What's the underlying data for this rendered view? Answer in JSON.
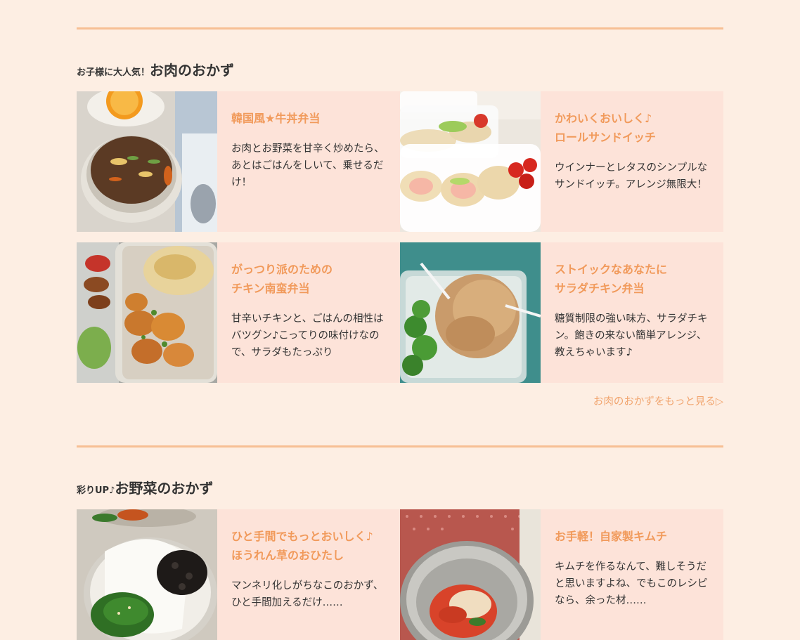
{
  "section1": {
    "title_small": "お子様に大人気！",
    "title_big": "お肉のおかず",
    "cards": [
      {
        "title": "韓国風★牛丼弁当",
        "text": "お肉とお野菜を甘辛く炒めたら、あとはごはんをしいて、乗せるだけ！",
        "image": "bulgogi-bento-photo"
      },
      {
        "title": "かわいくおいしく♪\nロールサンドイッチ",
        "text": "ウインナーとレタスのシンプルなサンドイッチ。アレンジ無限大！",
        "image": "roll-sandwich-photo"
      },
      {
        "title": "がっつり派のための\nチキン南蛮弁当",
        "text": "甘辛いチキンと、ごはんの相性はバツグン♪こってりの味付けなので、サラダもたっぷり",
        "image": "chicken-nanban-photo"
      },
      {
        "title": "ストイックなあなたに\nサラダチキン弁当",
        "text": "糖質制限の強い味方、サラダチキン。飽きの来ない簡単アレンジ、教えちゃいます♪",
        "image": "salad-chicken-photo"
      }
    ],
    "more_link": "お肉のおかずをもっと見る▷"
  },
  "section2": {
    "title_small": "彩りUP♪",
    "title_big": "お野菜のおかず",
    "cards": [
      {
        "title": "ひと手間でもっとおいしく♪\nほうれん草のおひたし",
        "text": "マンネリ化しがちなこのおかず、ひと手間加えるだけ……",
        "image": "spinach-ohitashi-photo"
      },
      {
        "title": "お手軽！自家製キムチ",
        "text": "キムチを作るなんて、難しそうだと思いますよね、でもこのレシピなら、余った材……",
        "image": "kimchi-photo"
      }
    ]
  },
  "colors": {
    "background": "#fdeee3",
    "card": "#fde3d9",
    "accent": "#f19a5b",
    "rule": "#f7bf94"
  }
}
